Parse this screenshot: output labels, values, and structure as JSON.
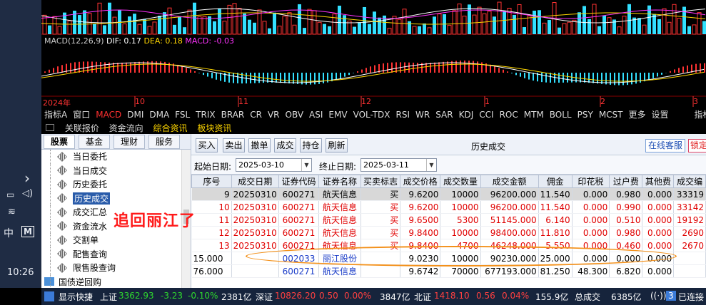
{
  "taskbar": {
    "chevron": "›",
    "ime_cn": "中",
    "ime_mode": "M",
    "clock": "10:26"
  },
  "chart": {
    "macd_name": "MACD(12,26,9)",
    "dif": "DIF: 0.17",
    "dea": "DEA: 0.18",
    "macd": "MACD: -0.03",
    "axis": [
      "2024年",
      "10",
      "11",
      "12",
      "1",
      "2",
      "3"
    ]
  },
  "indicator_tabs": [
    "指标A",
    "窗口",
    "MACD",
    "DMI",
    "DMA",
    "FSL",
    "TRIX",
    "BRAR",
    "CR",
    "VR",
    "OBV",
    "ASI",
    "EMV",
    "VOL-TDX",
    "RSI",
    "WR",
    "SAR",
    "KDJ",
    "CCI",
    "ROC",
    "MTM",
    "BOLL",
    "PSY",
    "MCST",
    "更多",
    "设置",
    "指标"
  ],
  "info_tabs": [
    "关联报价",
    "资金流向",
    "综合资讯",
    "板块资讯"
  ],
  "left_panel": {
    "tabs": [
      "股票",
      "基金",
      "理财",
      "服务"
    ],
    "tree": [
      "当日委托",
      "当日成交",
      "历史委托",
      "历史成交",
      "成交汇总",
      "资金流水",
      "交割单",
      "配售查询",
      "限售股查询"
    ],
    "partial_item": "国债逆回购"
  },
  "annotation": "追回丽江了",
  "toolbar": {
    "buttons": [
      "买入",
      "卖出",
      "撤单",
      "成交",
      "持仓",
      "刷新"
    ],
    "title": "历史成交",
    "customer_service": "在线客服",
    "lock": "锁定"
  },
  "date_filter": {
    "start_label": "起始日期:",
    "start_value": "2025-03-10",
    "end_label": "终止日期:",
    "end_value": "2025-03-11"
  },
  "table": {
    "headers": [
      "序号",
      "成交日期",
      "证券代码",
      "证券名称",
      "买卖标志",
      "成交价格",
      "成交数量",
      "成交金额",
      "佣金",
      "印花税",
      "过户费",
      "其他费",
      "成交编"
    ],
    "rows": [
      [
        "9",
        "20250310",
        "600271",
        "航天信息",
        "买",
        "9.6200",
        "10000",
        "96200.000",
        "11.540",
        "0.000",
        "0.980",
        "0.000",
        "33319"
      ],
      [
        "10",
        "20250310",
        "600271",
        "航天信息",
        "买",
        "9.6200",
        "10000",
        "96200.000",
        "11.540",
        "0.000",
        "0.990",
        "0.000",
        "33142"
      ],
      [
        "11",
        "20250310",
        "600271",
        "航天信息",
        "买",
        "9.6500",
        "5300",
        "51145.000",
        "6.140",
        "0.000",
        "0.510",
        "0.000",
        "19192"
      ],
      [
        "12",
        "20250310",
        "600271",
        "航天信息",
        "买",
        "9.8400",
        "10000",
        "98400.000",
        "11.810",
        "0.000",
        "0.980",
        "0.000",
        "2690"
      ],
      [
        "13",
        "20250310",
        "600271",
        "航天信息",
        "买",
        "9.8400",
        "4700",
        "46248.000",
        "5.550",
        "0.000",
        "0.460",
        "0.000",
        "2670"
      ]
    ],
    "summary_rows": [
      [
        "15.000",
        "",
        "002033",
        "丽江股份",
        "",
        "9.0230",
        "10000",
        "90230.000",
        "25.000",
        "0.000",
        "0.000",
        "0.000",
        ""
      ],
      [
        "76.000",
        "",
        "600271",
        "航天信息",
        "",
        "9.6742",
        "70000",
        "677193.000",
        "81.250",
        "48.300",
        "6.820",
        "0.000",
        ""
      ]
    ]
  },
  "status": {
    "quick": "显示快捷",
    "sh_label": "上证",
    "sh_value": "3362.93",
    "sh_change": "-3.23",
    "sh_pct": "-0.10%",
    "sh_vol": "2381亿",
    "sz_label": "深证",
    "sz_value": "10826.20",
    "sz_change": "0.50",
    "sz_pct": "0.00%",
    "sz_vol": "3847亿",
    "bz_label": "北证",
    "bz_value": "1418.10",
    "bz_change": "0.56",
    "bz_pct": "0.04%",
    "bz_vol": "155.9亿",
    "total_label": "总成交",
    "total_value": "6385亿",
    "notif_count": "3",
    "notif_label": "已连接"
  },
  "colors": {
    "up": "#ff3333",
    "down": "#2ed82e",
    "cyan": "#33e0ff",
    "highlight_oval": "#f39019",
    "annotation": "#ff1a1a"
  }
}
